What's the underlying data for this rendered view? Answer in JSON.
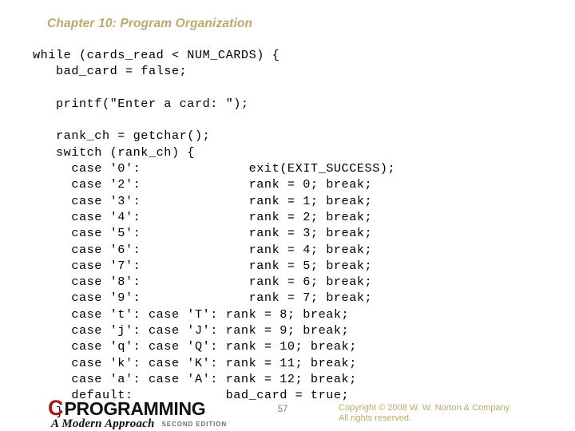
{
  "slide": {
    "title": "Chapter 10: Program Organization",
    "title_color": "#bfa969",
    "background_color": "#ffffff"
  },
  "code": {
    "language": "c",
    "text_color": "#000000",
    "lines": [
      "while (cards_read < NUM_CARDS) {",
      "   bad_card = false;",
      "",
      "   printf(\"Enter a card: \");",
      "",
      "   rank_ch = getchar();",
      "   switch (rank_ch) {",
      "     case '0':              exit(EXIT_SUCCESS);",
      "     case '2':              rank = 0; break;",
      "     case '3':              rank = 1; break;",
      "     case '4':              rank = 2; break;",
      "     case '5':              rank = 3; break;",
      "     case '6':              rank = 4; break;",
      "     case '7':              rank = 5; break;",
      "     case '8':              rank = 6; break;",
      "     case '9':              rank = 7; break;",
      "     case 't': case 'T': rank = 8; break;",
      "     case 'j': case 'J': rank = 9; break;",
      "     case 'q': case 'Q': rank = 10; break;",
      "     case 'k': case 'K': rank = 11; break;",
      "     case 'a': case 'A': rank = 12; break;",
      "     default:            bad_card = true;",
      "   }"
    ]
  },
  "footer": {
    "logo": {
      "letter": "C",
      "letter_color": "#a81a16",
      "wordmark": "PROGRAMMING",
      "subtitle": "A Modern Approach",
      "edition": "SECOND EDITION"
    },
    "page_number": "57",
    "copyright_line1": "Copyright © 2008 W. W. Norton & Company.",
    "copyright_line2": "All rights reserved.",
    "copyright_color": "#bfa969"
  }
}
